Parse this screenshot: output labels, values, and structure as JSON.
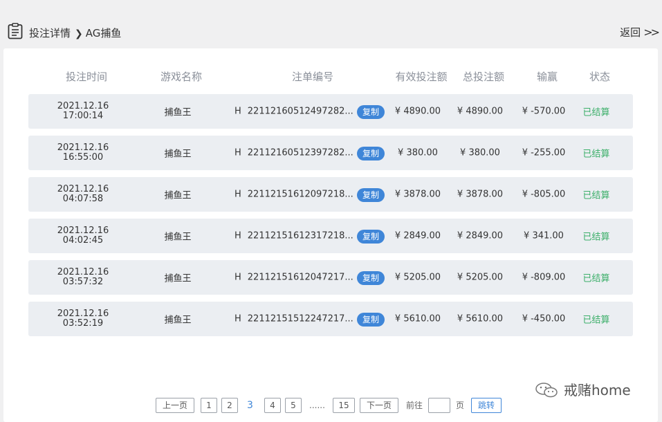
{
  "header": {
    "breadcrumb_parent": "投注详情",
    "breadcrumb_current": "AG捕鱼",
    "back_label": "返回",
    "back_arrows": ">>"
  },
  "table": {
    "columns": [
      "投注时间",
      "游戏名称",
      "注单编号",
      "有效投注额",
      "总投注额",
      "输赢",
      "状态"
    ],
    "copy_label": "复制",
    "rows": [
      {
        "date": "2021.12.16",
        "time": "17:00:14",
        "game": "捕鱼王",
        "prefix": "H",
        "order": "22112160512497282...",
        "valid": "¥ 4890.00",
        "total": "¥ 4890.00",
        "winloss": "¥ -570.00",
        "status": "已结算"
      },
      {
        "date": "2021.12.16",
        "time": "16:55:00",
        "game": "捕鱼王",
        "prefix": "H",
        "order": "22112160512397282...",
        "valid": "¥ 380.00",
        "total": "¥ 380.00",
        "winloss": "¥ -255.00",
        "status": "已结算"
      },
      {
        "date": "2021.12.16",
        "time": "04:07:58",
        "game": "捕鱼王",
        "prefix": "H",
        "order": "22112151612097218...",
        "valid": "¥ 3878.00",
        "total": "¥ 3878.00",
        "winloss": "¥ -805.00",
        "status": "已结算"
      },
      {
        "date": "2021.12.16",
        "time": "04:02:45",
        "game": "捕鱼王",
        "prefix": "H",
        "order": "22112151612317218...",
        "valid": "¥ 2849.00",
        "total": "¥ 2849.00",
        "winloss": "¥ 341.00",
        "status": "已结算"
      },
      {
        "date": "2021.12.16",
        "time": "03:57:32",
        "game": "捕鱼王",
        "prefix": "H",
        "order": "22112151612047217...",
        "valid": "¥ 5205.00",
        "total": "¥ 5205.00",
        "winloss": "¥ -809.00",
        "status": "已结算"
      },
      {
        "date": "2021.12.16",
        "time": "03:52:19",
        "game": "捕鱼王",
        "prefix": "H",
        "order": "22112151512247217...",
        "valid": "¥ 5610.00",
        "total": "¥ 5610.00",
        "winloss": "¥ -450.00",
        "status": "已结算"
      }
    ]
  },
  "pagination": {
    "prev_label": "上一页",
    "pages": [
      "1",
      "2",
      "3",
      "4",
      "5"
    ],
    "current_page": "3",
    "ellipsis": "......",
    "last_page": "15",
    "next_label": "下一页",
    "goto_prefix": "前往",
    "goto_input_value": "",
    "goto_suffix": "页",
    "jump_label": "跳转"
  },
  "watermark": {
    "text": "戒赌home"
  },
  "colors": {
    "background": "#f0f0f1",
    "row_background": "#ebeef2",
    "accent_blue": "#3f86d8",
    "status_green": "#3aae68",
    "header_text": "#8a8f99"
  }
}
